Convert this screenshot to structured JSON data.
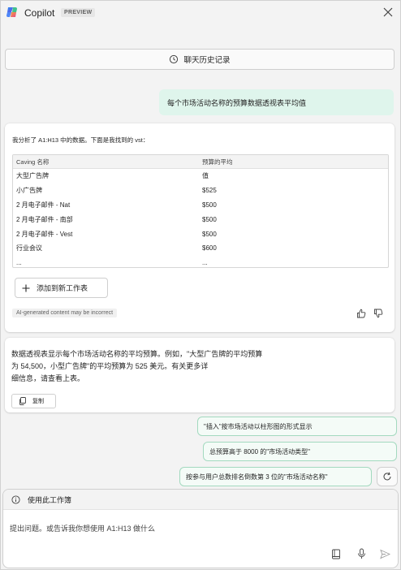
{
  "header": {
    "title": "Copilot",
    "badge": "PREVIEW"
  },
  "history_button": {
    "label": "聊天历史记录"
  },
  "user_message": "每个市场活动名称的预算数据透视表平均值",
  "response": {
    "intro": "我分析了 A1:H13 中的数据。下面是我找到的 vst：",
    "table": {
      "headers": [
        "Caving 名称",
        "预算的平均"
      ],
      "rows": [
        [
          "大型广告牌",
          "值"
        ],
        [
          "小广告牌",
          "$525"
        ],
        [
          "2 月电子邮件 - Nat",
          "$500"
        ],
        [
          "2 月电子邮件 - 南部",
          "$500"
        ],
        [
          "2 月电子邮件 - Vest",
          "$500"
        ],
        [
          "行业会议",
          "$600"
        ],
        [
          "...",
          "..."
        ]
      ]
    },
    "add_to_sheet_label": "添加到新工作表",
    "disclaimer": "AI-generated content may be incorrect"
  },
  "summary": {
    "line1": "数据透视表显示每个市场活动名称的平均预算。例如，\"大型广告牌的平均预算",
    "line2": "为 54,500，小型广告牌\"的平均预算为 525 美元。有关更多详",
    "line3": "细信息，请查看上表。",
    "copy_label": "复制"
  },
  "suggestions": [
    "\"插入\"按市场活动以柱形图的形式显示",
    "总预算高于 8000 的\"市场活动类型\"",
    "按参与用户总数排名倒数第 3 位的\"市场活动名称\""
  ],
  "composer": {
    "context_label": "使用此工作簿",
    "prompt": "提出问题。或告诉我你想使用 A1:H13 做什么"
  },
  "colors": {
    "user_bubble": "#dff5ec",
    "suggestion_border": "#a3d9bf"
  }
}
